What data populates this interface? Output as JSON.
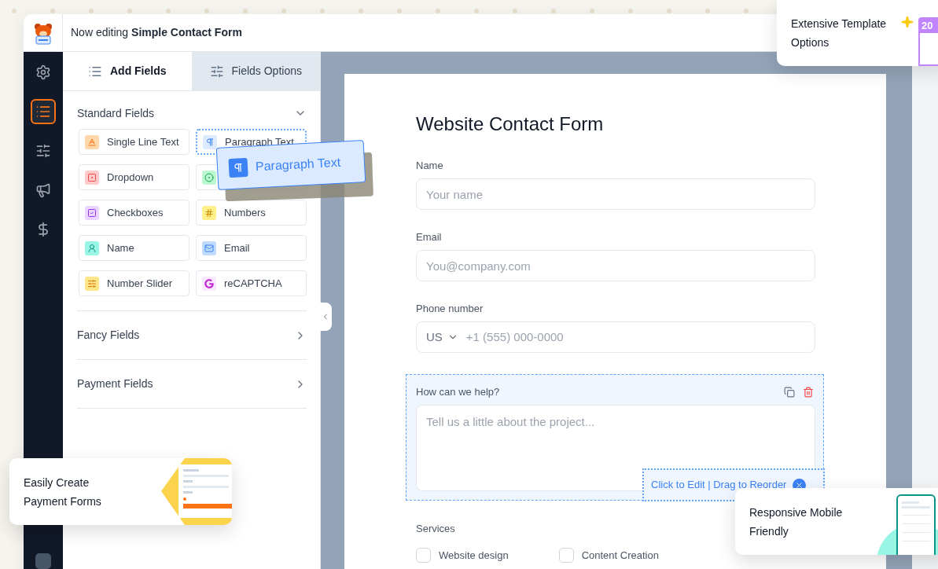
{
  "header": {
    "title": "Now editing **Simple Contact Form**"
  },
  "rail": [
    {
      "kind": "settings",
      "selected": false
    },
    {
      "kind": "forms",
      "selected": true
    },
    {
      "kind": "sliders",
      "selected": false
    },
    {
      "kind": "marketing",
      "selected": false
    },
    {
      "kind": "payments",
      "selected": false
    },
    {
      "kind": "blank",
      "selected": false
    }
  ],
  "panel": {
    "tabs": [
      {
        "kind": "add",
        "label": "Add Fields",
        "selected": true
      },
      {
        "kind": "options",
        "label": "Fields Options",
        "selected": false
      }
    ],
    "sections": [
      {
        "title": "Standard Fields",
        "expanded": true,
        "fields": [
          {
            "kind": "text",
            "label": "Single Line Text",
            "dragging": false
          },
          {
            "kind": "paragraph",
            "label": "Paragraph Text",
            "dragging": true
          },
          {
            "kind": "dropdown",
            "label": "Dropdown",
            "dragging": false
          },
          {
            "kind": "radio",
            "dragging": false
          },
          {
            "kind": "checkbox",
            "label": "Checkboxes",
            "dragging": false
          },
          {
            "kind": "number",
            "label": "Numbers",
            "dragging": false
          },
          {
            "kind": "name",
            "label": "Name",
            "dragging": false
          },
          {
            "kind": "email",
            "label": "Email",
            "dragging": false
          },
          {
            "kind": "slider",
            "label": "Number Slider",
            "dragging": false
          },
          {
            "kind": "captcha",
            "label": "reCAPTCHA",
            "dragging": false
          }
        ]
      },
      {
        "title": "Fancy Fields",
        "expanded": false
      },
      {
        "title": "Payment Fields",
        "expanded": false
      }
    ]
  },
  "drag_chip": {
    "label": "Paragraph Text"
  },
  "form": {
    "title": "Website Contact Form",
    "fields": [
      {
        "kind": "text",
        "label": "Name",
        "placeholder": "Your name",
        "selected": false
      },
      {
        "kind": "text",
        "label": "Email",
        "placeholder": "You@company.com",
        "selected": false
      },
      {
        "kind": "phone",
        "label": "Phone number",
        "country": "US",
        "placeholder": "+1 (555) 000-0000",
        "selected": false
      },
      {
        "kind": "textarea",
        "label": "How can we help?",
        "placeholder": "Tell us a little about the project...",
        "selected": true,
        "hint": "Click to Edit | Drag to Reorder"
      },
      {
        "kind": "checkboxes",
        "label": "Services",
        "selected": false,
        "options": [
          {
            "label": "Website design",
            "checked": false
          },
          {
            "label": "Content Creation",
            "checked": false
          }
        ]
      }
    ]
  },
  "promos": [
    {
      "kind": "templates",
      "text": "Extensive Template Options",
      "badge": "20"
    },
    {
      "kind": "payments",
      "text": "Easily Create Payment Forms"
    },
    {
      "kind": "mobile",
      "text": "Responsive Mobile Friendly"
    }
  ]
}
